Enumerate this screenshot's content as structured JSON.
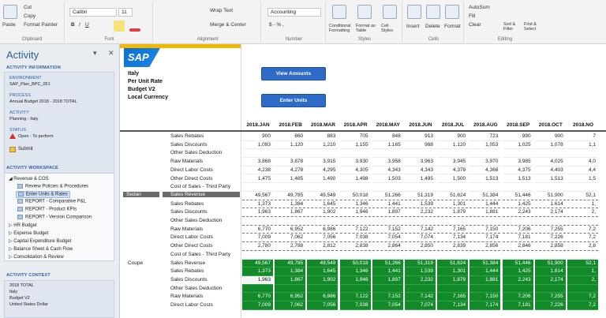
{
  "ribbon": {
    "clipboard": {
      "cut": "Cut",
      "copy": "Copy",
      "format_painter": "Format Painter",
      "paste": "Paste",
      "group": "Clipboard"
    },
    "font": {
      "name": "Calibri",
      "size": "11",
      "group": "Font"
    },
    "alignment": {
      "wrap": "Wrap Text",
      "merge": "Merge & Center",
      "group": "Alignment"
    },
    "number": {
      "format": "Accounting",
      "currency": "$ - % ,",
      "group": "Number"
    },
    "styles": {
      "conditional": "Conditional Formatting",
      "format_table": "Format as Table",
      "cell_styles": "Cell Styles",
      "group": "Styles"
    },
    "cells": {
      "insert": "Insert",
      "delete": "Delete",
      "format": "Format",
      "group": "Cells"
    },
    "editing": {
      "autosum": "AutoSum",
      "fill": "Fill",
      "clear": "Clear",
      "sort": "Sort & Filter",
      "find": "Find & Select",
      "group": "Editing"
    }
  },
  "panel": {
    "title": "Activity",
    "info_header": "ACTIVITY INFORMATION",
    "environment_label": "ENVIRONMENT",
    "environment_value": "SAP_Plan_BPC_051",
    "process_label": "PROCESS",
    "process_value": "Annual Budget 2018 - 2018 TOTAL",
    "activity_label": "ACTIVITY",
    "activity_value": "Planning - Italy",
    "status_label": "STATUS",
    "status_value": "Open - To perform",
    "submit": "Submit",
    "workspace_header": "ACTIVITY WORKSPACE",
    "tree": [
      "Revenue & COS",
      "Review Policies & Procedures",
      "Enter Units & Rates",
      "REPORT - Comparative P&L",
      "REPORT - Product KPIs",
      "REPORT - Version Comparison",
      "HR Budget",
      "Expense Budget",
      "Capital Expenditure Budget",
      "Balance Sheet & Cash Flow",
      "Consolidation & Review"
    ],
    "context_header": "ACTIVITY CONTEXT",
    "context": [
      "2018 TOTAL",
      "Italy",
      "Budget V2",
      "United States Dollar"
    ]
  },
  "sheet": {
    "logo": "SAP",
    "info": [
      "Italy",
      "Per Unit Rate",
      "Budget V2",
      "Local Currency"
    ],
    "btn_view": "View Amounts",
    "btn_enter": "Enter Units",
    "months": [
      "2018.JAN",
      "2018.FEB",
      "2018.MAR",
      "2018.APR",
      "2018.MAY",
      "2018.JUN",
      "2018.JUL",
      "2018.AUG",
      "2018.SEP",
      "2018.OCT",
      "2018.NO"
    ],
    "rows": [
      {
        "group": "",
        "label": "Sales Rebates",
        "vals": [
          "900",
          "860",
          "883",
          "705",
          "848",
          "913",
          "900",
          "723",
          "990",
          "900",
          "7"
        ],
        "style": ""
      },
      {
        "group": "",
        "label": "Sales Discounts",
        "vals": [
          "1,093",
          "1,120",
          "1,210",
          "1,155",
          "1,165",
          "988",
          "1,120",
          "1,053",
          "1,025",
          "1,078",
          "1,1"
        ],
        "style": ""
      },
      {
        "group": "",
        "label": "Other Sales Deduction",
        "vals": [
          "",
          "",
          "",
          "",
          "",
          "",
          "",
          "",
          "",
          "",
          ""
        ],
        "style": ""
      },
      {
        "group": "",
        "label": "Raw Materials",
        "vals": [
          "3,868",
          "3,878",
          "3,915",
          "3,930",
          "3,958",
          "3,963",
          "3,945",
          "3,970",
          "3,985",
          "4,025",
          "4,0"
        ],
        "style": ""
      },
      {
        "group": "",
        "label": "Direct Labor Costs",
        "vals": [
          "4,238",
          "4,278",
          "4,295",
          "4,305",
          "4,343",
          "4,343",
          "4,378",
          "4,368",
          "4,375",
          "4,403",
          "4,4"
        ],
        "style": ""
      },
      {
        "group": "",
        "label": "Other Direct Costs",
        "vals": [
          "1,475",
          "1,485",
          "1,490",
          "1,498",
          "1,503",
          "1,495",
          "1,500",
          "1,513",
          "1,513",
          "1,513",
          "1,5"
        ],
        "style": ""
      },
      {
        "group": "",
        "label": "Cost of Sales - Third Party",
        "vals": [
          "",
          "",
          "",
          "",
          "",
          "",
          "",
          "",
          "",
          "",
          ""
        ],
        "style": ""
      },
      {
        "group": "Sedan",
        "label": "Sales Revenue",
        "vals": [
          "49,567",
          "49,785",
          "49,549",
          "50,018",
          "51,266",
          "51,319",
          "51,624",
          "51,384",
          "51,446",
          "51,900",
          "52,1"
        ],
        "style": "dash"
      },
      {
        "group": "",
        "label": "Sales Rebates",
        "vals": [
          "1,373",
          "1,384",
          "1,645",
          "1,346",
          "1,441",
          "1,539",
          "1,301",
          "1,444",
          "1,425",
          "1,614",
          "1,"
        ],
        "style": "dash"
      },
      {
        "group": "",
        "label": "Sales Discounts",
        "vals": [
          "1,963",
          "1,867",
          "1,902",
          "1,946",
          "1,897",
          "2,232",
          "1,879",
          "1,881",
          "2,243",
          "2,174",
          "2,"
        ],
        "style": "dash"
      },
      {
        "group": "",
        "label": "Other Sales Deduction",
        "vals": [
          "",
          "",
          "",
          "",
          "",
          "",
          "",
          "",
          "",
          "",
          ""
        ],
        "style": "dash"
      },
      {
        "group": "",
        "label": "Raw Materials",
        "vals": [
          "6,770",
          "6,952",
          "6,986",
          "7,122",
          "7,152",
          "7,142",
          "7,165",
          "7,150",
          "7,206",
          "7,255",
          "7,2"
        ],
        "style": "dash"
      },
      {
        "group": "",
        "label": "Direct Labor Costs",
        "vals": [
          "7,009",
          "7,062",
          "7,056",
          "7,038",
          "7,054",
          "7,074",
          "7,134",
          "7,174",
          "7,181",
          "7,226",
          "7,2"
        ],
        "style": "dash"
      },
      {
        "group": "",
        "label": "Other Direct Costs",
        "vals": [
          "2,780",
          "2,788",
          "2,812",
          "2,838",
          "2,864",
          "2,850",
          "2,839",
          "2,856",
          "2,846",
          "2,858",
          "2,8"
        ],
        "style": "dash"
      },
      {
        "group": "",
        "label": "Cost of Sales - Third Party",
        "vals": [
          "",
          "",
          "",
          "",
          "",
          "",
          "",
          "",
          "",
          "",
          ""
        ],
        "style": ""
      },
      {
        "group": "Coupe",
        "label": "Sales Revenue",
        "vals": [
          "49,567",
          "49,785",
          "49,549",
          "50,018",
          "51,266",
          "51,319",
          "51,624",
          "51,384",
          "51,446",
          "51,900",
          "52,1"
        ],
        "style": "green"
      },
      {
        "group": "",
        "label": "Sales Rebates",
        "vals": [
          "1,373",
          "1,384",
          "1,645",
          "1,346",
          "1,441",
          "1,539",
          "1,301",
          "1,444",
          "1,425",
          "1,614",
          "1,"
        ],
        "style": "green"
      },
      {
        "group": "",
        "label": "Sales Discounts",
        "vals": [
          "1,963",
          "1,867",
          "1,902",
          "1,946",
          "1,897",
          "2,232",
          "1,879",
          "1,881",
          "2,243",
          "2,174",
          "2,"
        ],
        "style": "green"
      },
      {
        "group": "",
        "label": "Other Sales Deduction",
        "vals": [
          "",
          "",
          "",
          "",
          "",
          "",
          "",
          "",
          "",
          "",
          ""
        ],
        "style": "green"
      },
      {
        "group": "",
        "label": "Raw Materials",
        "vals": [
          "6,770",
          "6,952",
          "6,986",
          "7,122",
          "7,152",
          "7,142",
          "7,165",
          "7,150",
          "7,206",
          "7,255",
          "7,2"
        ],
        "style": "green"
      },
      {
        "group": "",
        "label": "Direct Labor Costs",
        "vals": [
          "7,009",
          "7,062",
          "7,056",
          "7,038",
          "7,054",
          "7,074",
          "7,134",
          "7,174",
          "7,181",
          "7,226",
          "7,2"
        ],
        "style": "green"
      }
    ]
  }
}
